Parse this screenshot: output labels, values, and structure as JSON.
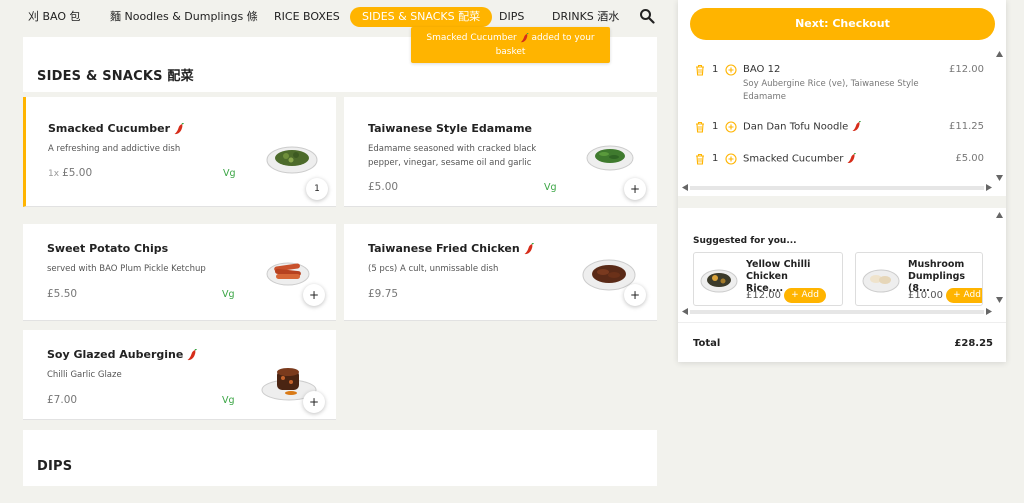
{
  "nav": {
    "items": [
      {
        "label": "刈 BAO 包"
      },
      {
        "label": "麵 Noodles & Dumplings 條"
      },
      {
        "label": "RICE BOXES"
      },
      {
        "label": "SIDES & SNACKS 配菜"
      },
      {
        "label": "DIPS"
      },
      {
        "label": "DRINKS 酒水"
      }
    ],
    "active_index": 3,
    "search_icon": "search-icon"
  },
  "toast": {
    "text_before": "Smacked Cucumber",
    "text_after": "added to your basket"
  },
  "sections": {
    "sides_title": "SIDES & SNACKS 配菜",
    "dips_title": "DIPS"
  },
  "items": [
    {
      "name": "Smacked Cucumber",
      "spicy": true,
      "desc": "A refreshing and addictive dish",
      "qty_prefix": "1x",
      "price": "£5.00",
      "tag": "Vg",
      "button": "1"
    },
    {
      "name": "Taiwanese Style Edamame",
      "spicy": false,
      "desc": "Edamame seasoned with cracked black pepper, vinegar, sesame oil and garlic",
      "price": "£5.00",
      "tag": "Vg",
      "button": "+"
    },
    {
      "name": "Sweet Potato Chips",
      "spicy": false,
      "desc": "served with BAO Plum Pickle Ketchup",
      "price": "£5.50",
      "tag": "Vg",
      "button": "+"
    },
    {
      "name": "Taiwanese Fried Chicken",
      "spicy": true,
      "desc": "(5 pcs) A cult, unmissable dish",
      "price": "£9.75",
      "tag": "",
      "button": "+"
    },
    {
      "name": "Soy Glazed Aubergine",
      "spicy": true,
      "desc": "Chilli Garlic Glaze",
      "price": "£7.00",
      "tag": "Vg",
      "button": "+"
    }
  ],
  "basket": {
    "checkout_label": "Next: Checkout",
    "items": [
      {
        "qty": "1",
        "name": "BAO 12",
        "spicy": false,
        "options": "Soy Aubergine Rice (ve), Taiwanese Style Edamame",
        "price": "£12.00"
      },
      {
        "qty": "1",
        "name": "Dan Dan Tofu Noodle",
        "spicy": true,
        "options": "",
        "price": "£11.25"
      },
      {
        "qty": "1",
        "name": "Smacked Cucumber",
        "spicy": true,
        "options": "",
        "price": "£5.00"
      }
    ],
    "suggested_title": "Suggested for you...",
    "suggestions": [
      {
        "name": "Yellow Chilli Chicken Rice,...",
        "price": "£12.00",
        "add_label": "+ Add"
      },
      {
        "name": "Mushroom Dumplings (8...",
        "price": "£10.00",
        "add_label": "+ Add"
      }
    ],
    "total_label": "Total",
    "total_value": "£28.25"
  },
  "colors": {
    "accent": "#ffb400",
    "vegan": "#3aa544",
    "background": "#f2f2ed",
    "chili": "#d62d1a"
  }
}
